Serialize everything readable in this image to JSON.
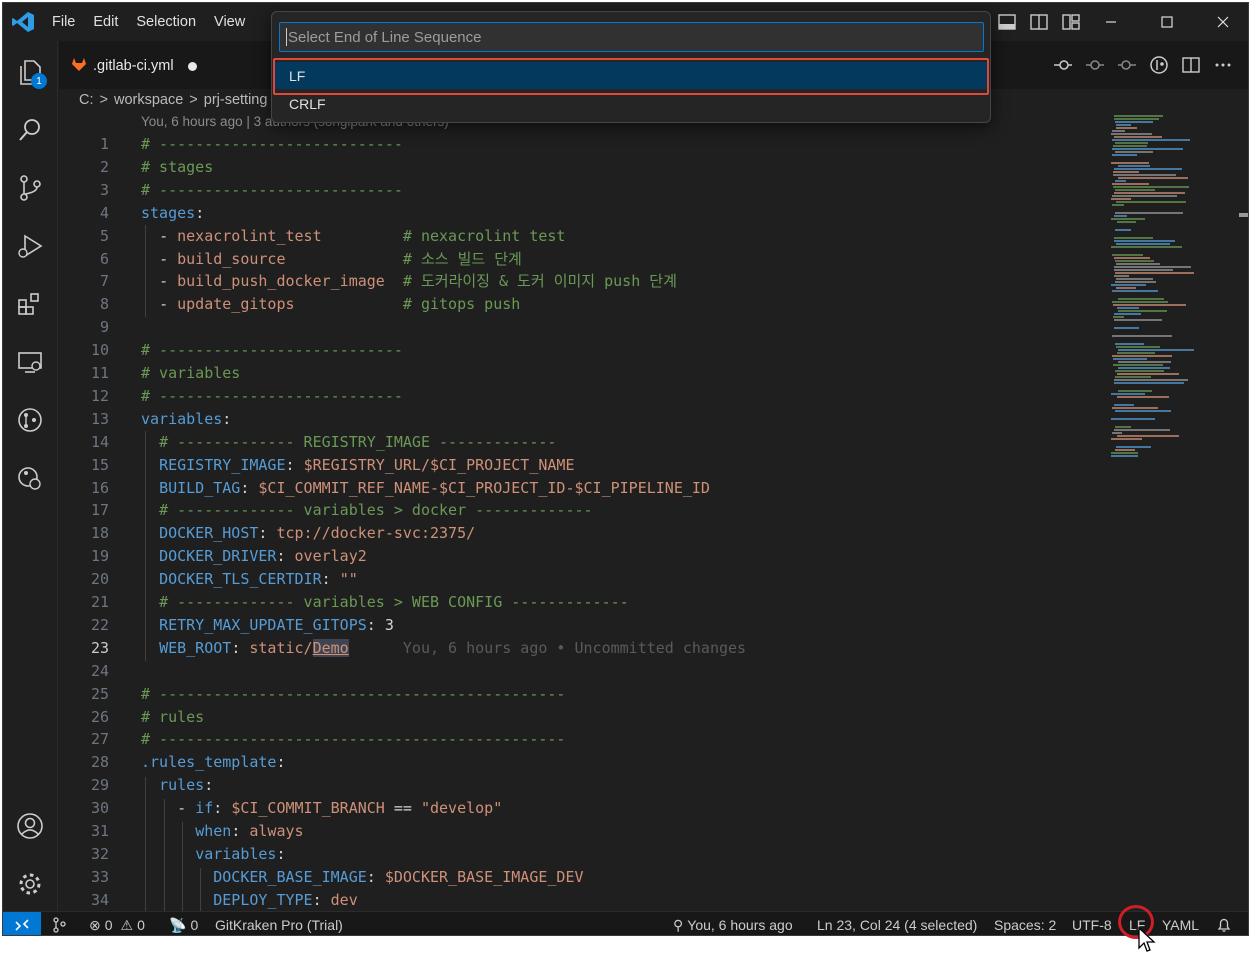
{
  "menu": [
    "File",
    "Edit",
    "Selection",
    "View"
  ],
  "quick_pick": {
    "placeholder": "Select End of Line Sequence",
    "items": [
      {
        "label": "LF",
        "selected": true
      },
      {
        "label": "CRLF",
        "selected": false
      }
    ]
  },
  "tab": {
    "label": ".gitlab-ci.yml",
    "modified": true
  },
  "explorer_badge": "1",
  "breadcrumb": [
    "C:",
    "workspace",
    "prj-setting"
  ],
  "blame_header": "You, 6 hours ago | 3 authors (songipark and others)",
  "code_lines": [
    {
      "n": "1",
      "t": "# ---------------------------"
    },
    {
      "n": "2",
      "t": "# stages"
    },
    {
      "n": "3",
      "t": "# ---------------------------"
    },
    {
      "n": "4",
      "t": "stages:"
    },
    {
      "n": "5",
      "t": "  - nexacrolint_test",
      "c": "# nexacrolint test"
    },
    {
      "n": "6",
      "t": "  - build_source",
      "c": "# 소스 빌드 단계"
    },
    {
      "n": "7",
      "t": "  - build_push_docker_image",
      "c": "# 도커라이징 & 도커 이미지 push 단계"
    },
    {
      "n": "8",
      "t": "  - update_gitops",
      "c": "# gitops push"
    },
    {
      "n": "9",
      "t": ""
    },
    {
      "n": "10",
      "t": "# ---------------------------"
    },
    {
      "n": "11",
      "t": "# variables"
    },
    {
      "n": "12",
      "t": "# ---------------------------"
    },
    {
      "n": "13",
      "t": "variables:"
    },
    {
      "n": "14",
      "t": "  # ------------- REGISTRY_IMAGE -------------"
    },
    {
      "n": "15",
      "t": "  REGISTRY_IMAGE: $REGISTRY_URL/$CI_PROJECT_NAME"
    },
    {
      "n": "16",
      "t": "  BUILD_TAG: $CI_COMMIT_REF_NAME-$CI_PROJECT_ID-$CI_PIPELINE_ID"
    },
    {
      "n": "17",
      "t": "  # ------------- variables > docker -------------"
    },
    {
      "n": "18",
      "t": "  DOCKER_HOST: tcp://docker-svc:2375/"
    },
    {
      "n": "19",
      "t": "  DOCKER_DRIVER: overlay2"
    },
    {
      "n": "20",
      "t": "  DOCKER_TLS_CERTDIR: \"\""
    },
    {
      "n": "21",
      "t": "  # ------------- variables > WEB CONFIG -------------"
    },
    {
      "n": "22",
      "t": "  RETRY_MAX_UPDATE_GITOPS: 3"
    },
    {
      "n": "23",
      "t": "  WEB_ROOT: static/Demo",
      "ghost": "You, 6 hours ago • Uncommitted changes"
    },
    {
      "n": "24",
      "t": ""
    },
    {
      "n": "25",
      "t": "# ---------------------------------------------"
    },
    {
      "n": "26",
      "t": "# rules"
    },
    {
      "n": "27",
      "t": "# ---------------------------------------------"
    },
    {
      "n": "28",
      "t": ".rules_template:"
    },
    {
      "n": "29",
      "t": "  rules:"
    },
    {
      "n": "30",
      "t": "    - if: $CI_COMMIT_BRANCH == \"develop\""
    },
    {
      "n": "31",
      "t": "      when: always"
    },
    {
      "n": "32",
      "t": "      variables:"
    },
    {
      "n": "33",
      "t": "        DOCKER_BASE_IMAGE: $DOCKER_BASE_IMAGE_DEV"
    },
    {
      "n": "34",
      "t": "        DEPLOY_TYPE: dev"
    }
  ],
  "status": {
    "problems_errors": "0",
    "problems_warnings": "0",
    "ports": "0",
    "gitkraken": "GitKraken Pro (Trial)",
    "blame": "You, 6 hours ago",
    "position": "Ln 23, Col 24 (4 selected)",
    "spaces": "Spaces: 2",
    "encoding": "UTF-8",
    "eol": "LF",
    "language": "YAML"
  },
  "colors": {
    "accent": "#0078d4",
    "highlight": "#e0483e",
    "selected_item": "#04395e"
  }
}
